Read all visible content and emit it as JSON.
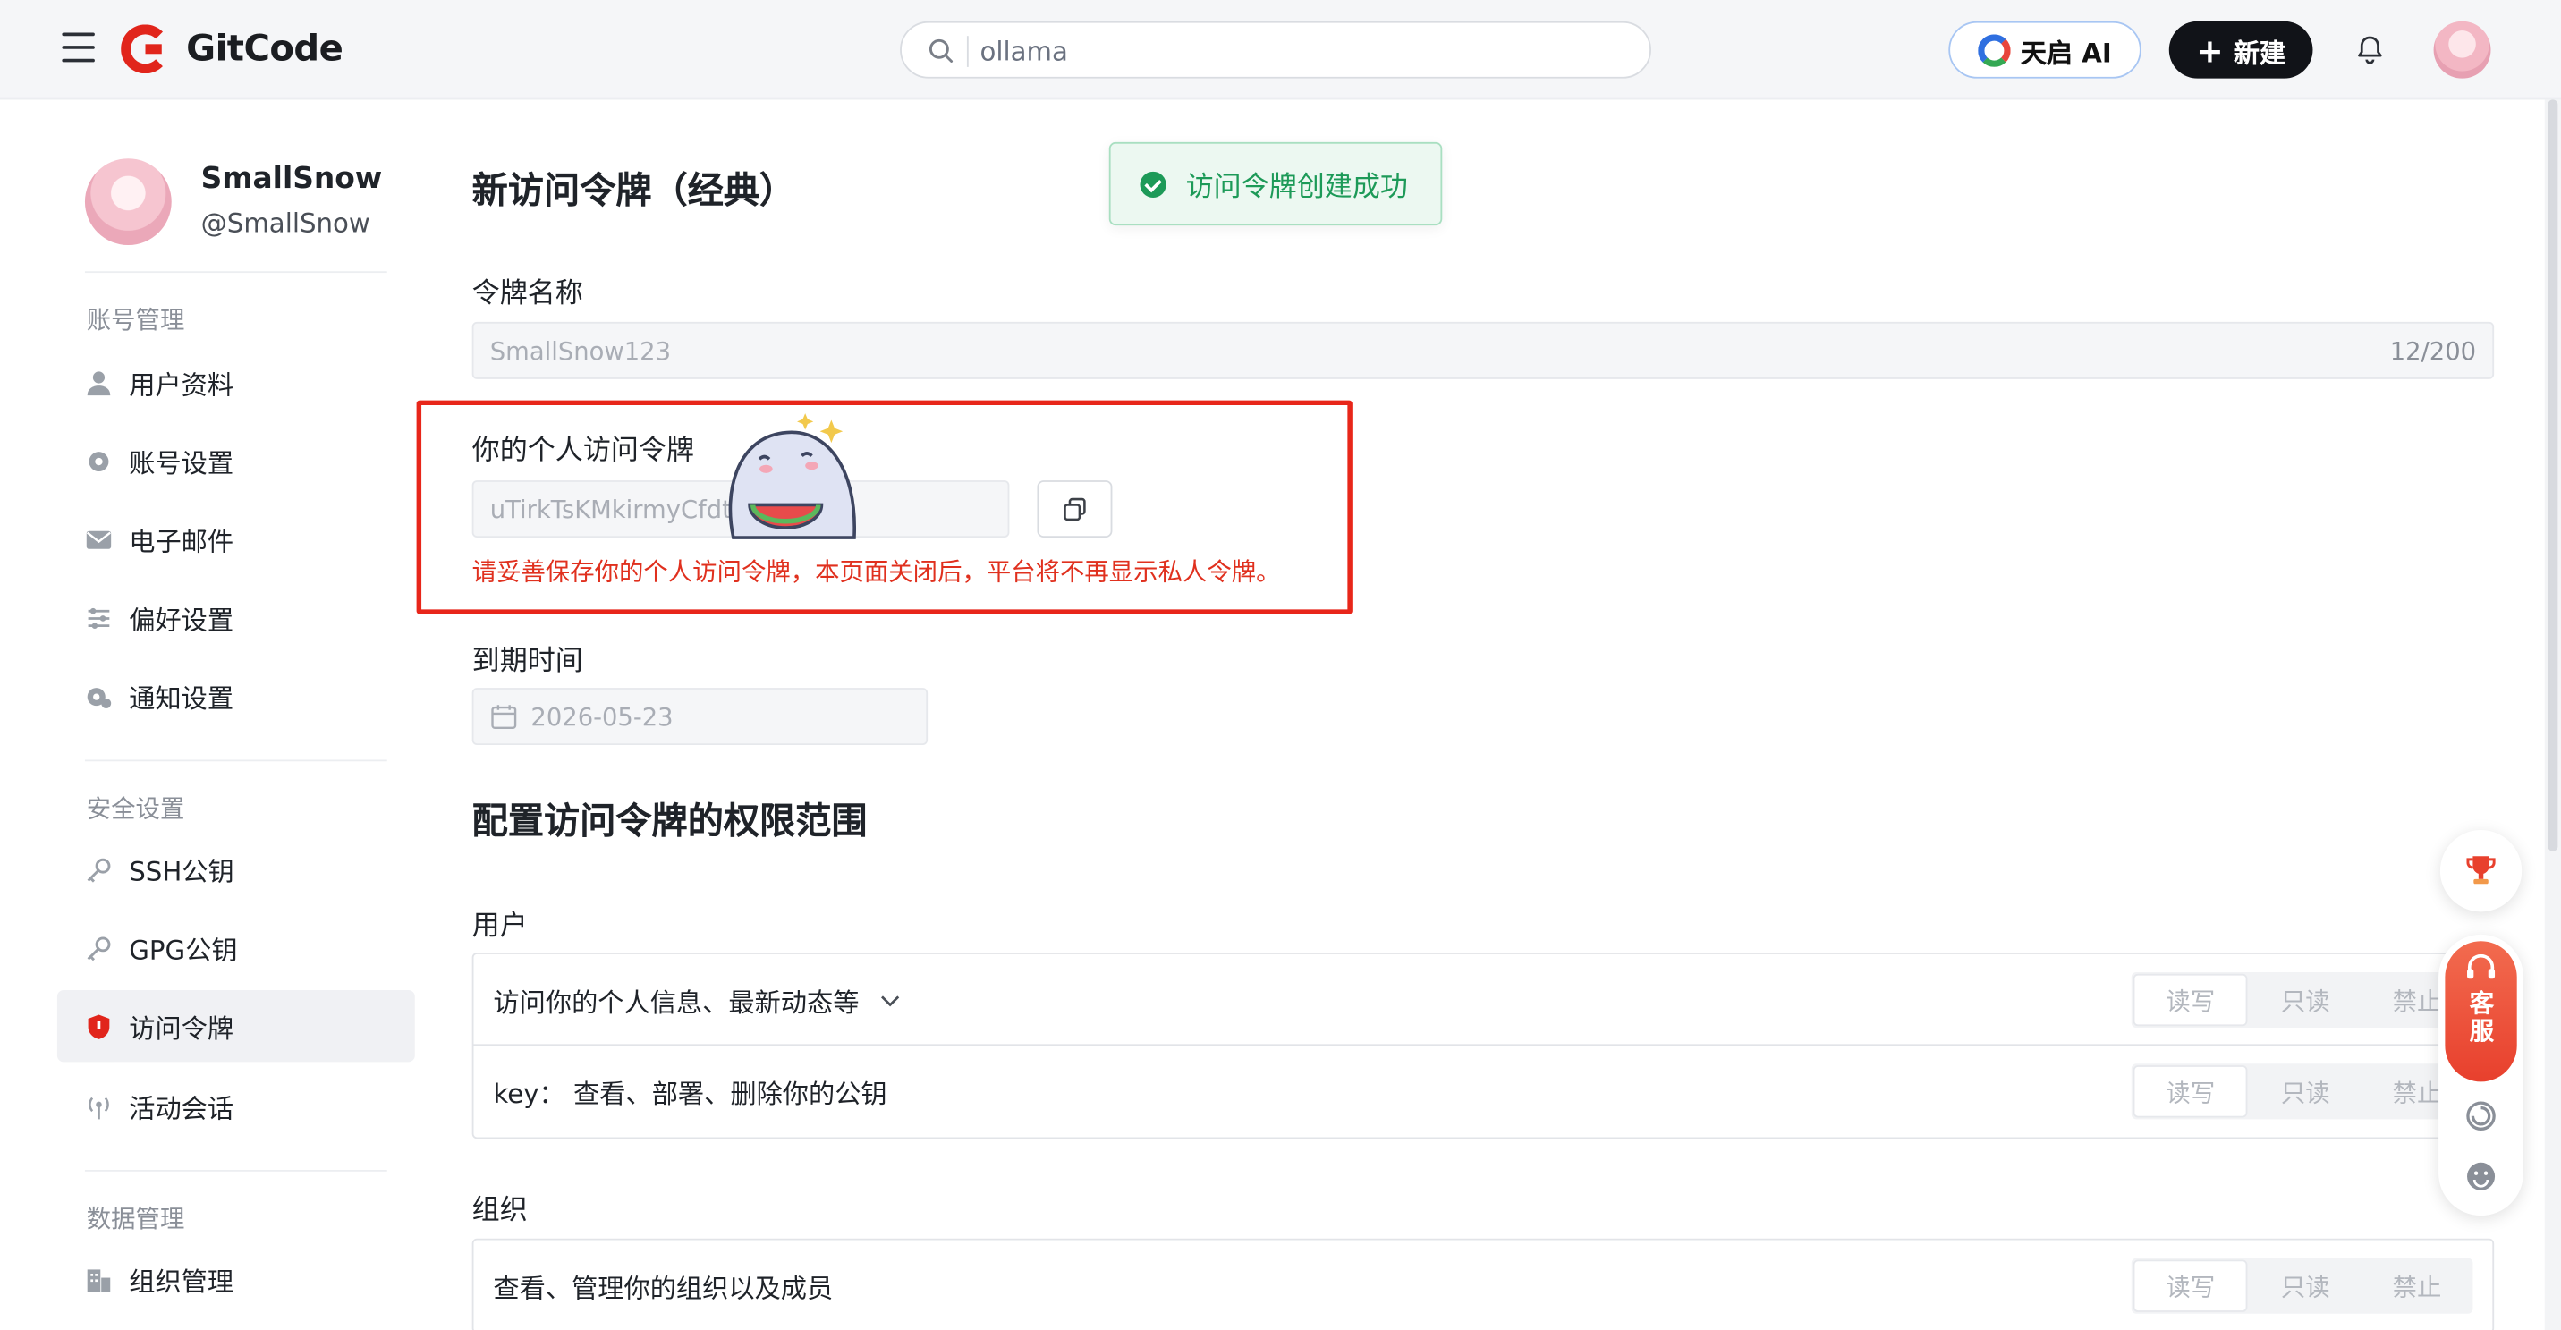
{
  "header": {
    "brand": "GitCode",
    "search_value": "ollama",
    "ai_label": "天启 AI",
    "new_label": "新建"
  },
  "sidebar": {
    "name": "SmallSnow",
    "handle": "@SmallSnow",
    "groups": [
      "账号管理",
      "安全设置",
      "数据管理"
    ],
    "items": [
      {
        "label": "用户资料",
        "icon": "user-icon"
      },
      {
        "label": "账号设置",
        "icon": "gear-icon"
      },
      {
        "label": "电子邮件",
        "icon": "mail-icon"
      },
      {
        "label": "偏好设置",
        "icon": "sliders-icon"
      },
      {
        "label": "通知设置",
        "icon": "notification-gear-icon"
      },
      {
        "label": "SSH公钥",
        "icon": "key-icon"
      },
      {
        "label": "GPG公钥",
        "icon": "key-icon"
      },
      {
        "label": "访问令牌",
        "icon": "shield-icon",
        "active": true
      },
      {
        "label": "活动会话",
        "icon": "broadcast-icon"
      },
      {
        "label": "组织管理",
        "icon": "building-icon"
      }
    ]
  },
  "main": {
    "title": "新访问令牌（经典）",
    "token_name_label": "令牌名称",
    "token_name_value": "SmallSnow123",
    "token_name_counter": "12/200",
    "token_label": "你的个人访问令牌",
    "token_value": "uTirkTsKMkirmyCfdt",
    "warning": "请妥善保存你的个人访问令牌，本页面关闭后，平台将不再显示私人令牌。",
    "expiry_label": "到期时间",
    "expiry_value": "2026-05-23",
    "scope_title": "配置访问令牌的权限范围",
    "scopes": [
      {
        "group": "用户",
        "rows": [
          {
            "text": "访问你的个人信息、最新动态等",
            "expandable": true
          },
          {
            "text": "key：  查看、部署、删除你的公钥",
            "expandable": false
          }
        ]
      },
      {
        "group": "组织",
        "rows": [
          {
            "text": "查看、管理你的组织以及成员",
            "expandable": false
          }
        ]
      }
    ],
    "perm_options": [
      "读写",
      "只读",
      "禁止"
    ]
  },
  "toast": {
    "message": "访问令牌创建成功",
    "status_color": "#1d9a58"
  },
  "floating": {
    "service_label": "客服"
  },
  "colors": {
    "brand": "#e1251b",
    "warning": "#e0301e",
    "success": "#1d9a58"
  }
}
